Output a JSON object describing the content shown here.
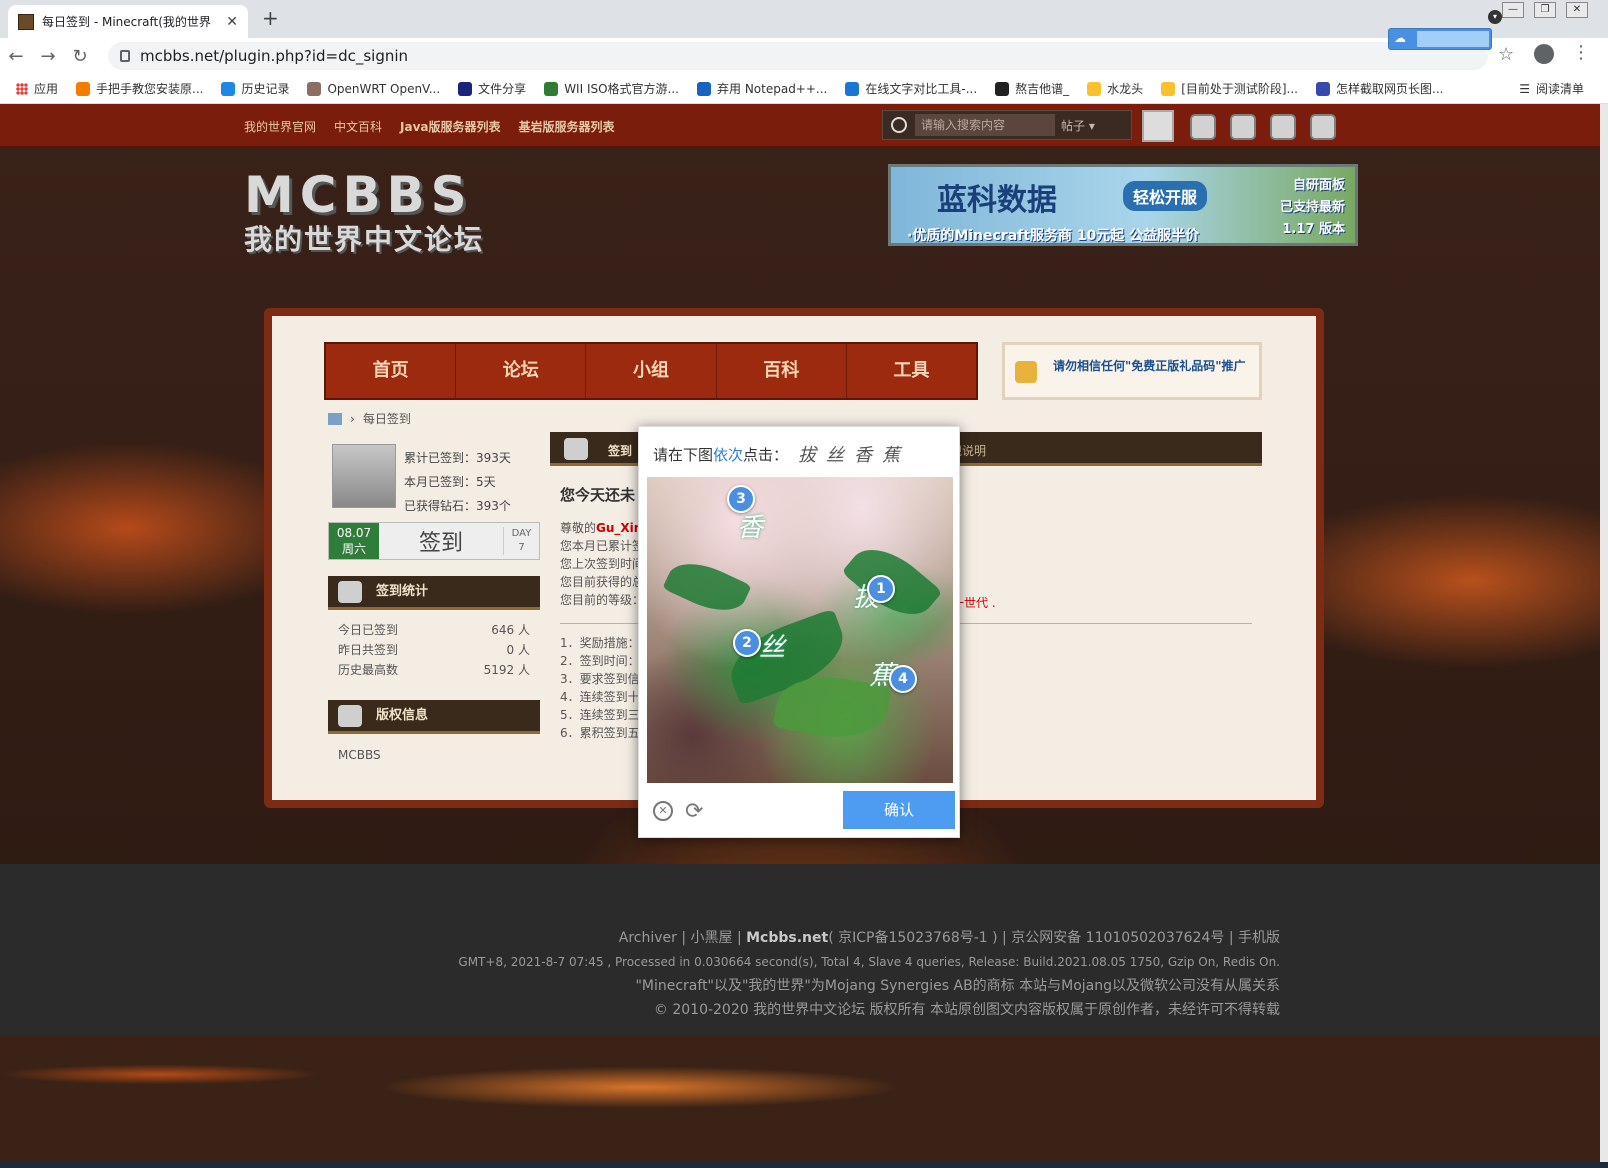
{
  "browser": {
    "tab_title": "每日签到 - Minecraft(我的世界",
    "tab_close": "✕",
    "new_tab": "+",
    "url": "mcbbs.net/plugin.php?id=dc_signin",
    "reading_list": "阅读清单",
    "bookmarks": [
      {
        "label": "应用",
        "color": "#e53935"
      },
      {
        "label": "手把手教您安装原...",
        "color": "#f57c00"
      },
      {
        "label": "历史记录",
        "color": "#1e88e5"
      },
      {
        "label": "OpenWRT OpenV...",
        "color": "#8d6e63"
      },
      {
        "label": "文件分享",
        "color": "#1a237e"
      },
      {
        "label": "WII ISO格式官方游...",
        "color": "#2e7d32"
      },
      {
        "label": "弃用 Notepad++...",
        "color": "#1565c0"
      },
      {
        "label": "在线文字对比工具-...",
        "color": "#1976d2"
      },
      {
        "label": "熬吉他谱_",
        "color": "#212121"
      },
      {
        "label": "水龙头",
        "color": "#fbc02d"
      },
      {
        "label": "[目前处于测试阶段]...",
        "color": "#fbc02d"
      },
      {
        "label": "怎样截取网页长图...",
        "color": "#3949ab"
      }
    ]
  },
  "site": {
    "top_links": [
      "我的世界官网",
      "中文百科",
      "Java版服务器列表",
      "基岩版服务器列表"
    ],
    "search_placeholder": "请输入搜索内容",
    "search_scope": "帖子",
    "logo_line1": "MCBBS",
    "logo_line2": "我的世界中文论坛",
    "banner": {
      "title": "蓝科数据",
      "pill": "轻松开服",
      "tagline": "·优质的Minecraft服务商 10元起 公益服半价",
      "side1": "自研面板",
      "side2": "已支持最新",
      "side3": "1.17 版本"
    },
    "main_nav": [
      "首页",
      "论坛",
      "小组",
      "百科",
      "工具"
    ],
    "notice": "请勿相信任何\"免费正版礼品码\"推广",
    "breadcrumb": "每日签到",
    "user": {
      "total": "累计已签到：393天",
      "month": "本月已签到：5天",
      "diamonds": "已获得钻石：393个"
    },
    "sign": {
      "date": "08.07",
      "weekday": "周六",
      "label": "签到",
      "day_label": "DAY",
      "day_num": "7"
    },
    "stats_title": "签到统计",
    "stats": [
      {
        "label": "今日已签到",
        "value": "646 人"
      },
      {
        "label": "昨日共签到",
        "value": "0 人"
      },
      {
        "label": "历史最高数",
        "value": "5192 人"
      }
    ],
    "copyright_title": "版权信息",
    "copyright_text": "MCBBS",
    "content": {
      "bar_label": "签到",
      "rules_label": "规说明",
      "heading": "您今天还未",
      "greet1_prefix": "尊敬的",
      "greet1_name": "Gu_Xin",
      "greet2": "您本月已累计签",
      "greet3": "您上次签到时间",
      "greet4": "您目前获得的总",
      "greet5": "您目前的等级：",
      "era": "一世代 .",
      "rules": [
        "1．奖励措施：",
        "2．签到时间：",
        "3．要求签到信",
        "4．连续签到十",
        "5．连续签到三",
        "6．累积签到五"
      ]
    }
  },
  "footer": {
    "line1_a": "Archiver | 小黑屋 | ",
    "line1_b": "Mcbbs.net",
    "line1_c": "( 京ICP备15023768号-1 ) | 京公网安备 11010502037624号 | 手机版",
    "line2": "GMT+8, 2021-8-7 07:45 , Processed in 0.030664 second(s), Total 4, Slave 4 queries, Release: Build.2021.08.05 1750, Gzip On, Redis On.",
    "line3": "\"Minecraft\"以及\"我的世界\"为Mojang Synergies AB的商标 本站与Mojang以及微软公司没有从属关系",
    "line4": "© 2010-2020 我的世界中文论坛 版权所有 本站原创图文内容版权属于原创作者，未经许可不得转载"
  },
  "captcha": {
    "prompt_a": "请在下图",
    "prompt_hl": "依次",
    "prompt_b": "点击：",
    "chars": "拔丝香蕉",
    "markers": [
      "1",
      "2",
      "3",
      "4"
    ],
    "confirm": "确认"
  }
}
